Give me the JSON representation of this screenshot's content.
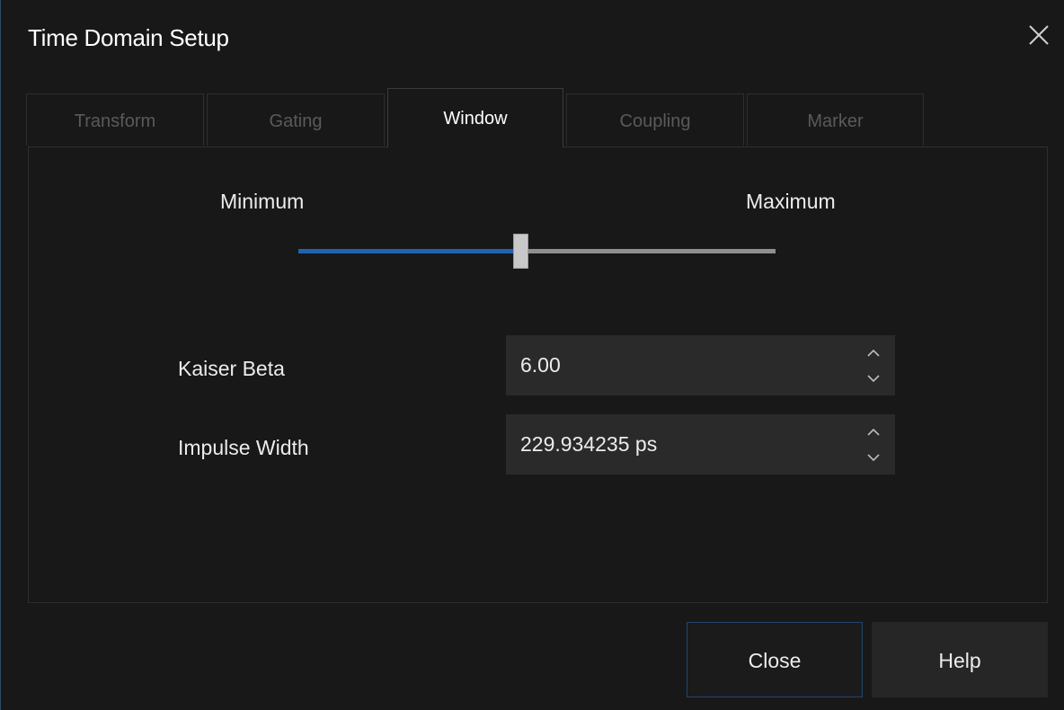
{
  "window": {
    "title": "Time Domain Setup",
    "close_icon": "close-icon"
  },
  "tabs": [
    {
      "label": "Transform",
      "active": false
    },
    {
      "label": "Gating",
      "active": false
    },
    {
      "label": "Window",
      "active": true
    },
    {
      "label": "Coupling",
      "active": false
    },
    {
      "label": "Marker",
      "active": false
    }
  ],
  "window_panel": {
    "slider": {
      "min_label": "Minimum",
      "max_label": "Maximum",
      "position_fraction": 0.465,
      "fill_color": "#1f64b3",
      "track_color": "#8f8f8f"
    },
    "kaiser_beta": {
      "label": "Kaiser Beta",
      "value": "6.00"
    },
    "impulse_width": {
      "label": "Impulse Width",
      "value": "229.934235 ps"
    }
  },
  "buttons": {
    "close_label": "Close",
    "help_label": "Help"
  },
  "colors": {
    "background": "#181818",
    "accent": "#1f64b3",
    "close_border": "#23466e"
  }
}
